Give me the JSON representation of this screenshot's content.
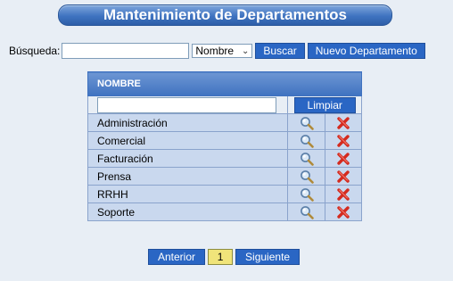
{
  "page_title": "Mantenimiento de Departamentos",
  "search": {
    "label": "Búsqueda:",
    "value": "",
    "field_selected": "Nombre",
    "buscar_label": "Buscar",
    "nuevo_label": "Nuevo Departamento"
  },
  "grid": {
    "header": "NOMBRE",
    "filter_value": "",
    "limpiar_label": "Limpiar",
    "rows": [
      {
        "name": "Administración"
      },
      {
        "name": "Comercial"
      },
      {
        "name": "Facturación"
      },
      {
        "name": "Prensa"
      },
      {
        "name": "RRHH"
      },
      {
        "name": "Soporte"
      }
    ]
  },
  "pager": {
    "prev_label": "Anterior",
    "current_page": "1",
    "next_label": "Siguiente"
  }
}
